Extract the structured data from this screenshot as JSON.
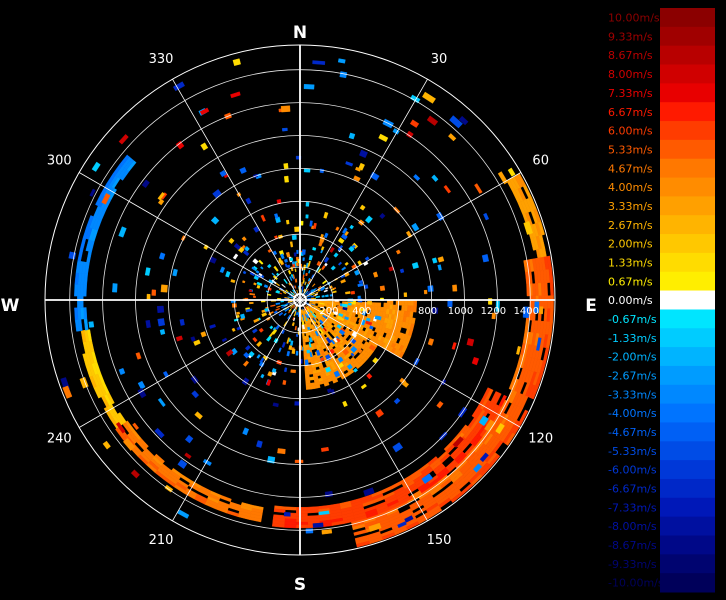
{
  "chart_data": {
    "type": "heatmap",
    "subtype": "polar-radial-velocity",
    "cardinals": [
      "N",
      "E",
      "S",
      "W"
    ],
    "azimuth_labels": [
      30,
      60,
      120,
      150,
      210,
      240,
      300,
      330
    ],
    "range_ticks": [
      200,
      400,
      800,
      1000,
      1200,
      1400
    ],
    "range_max": 1550,
    "range_ring_step": 200,
    "spoke_step_deg": 30,
    "legend": {
      "labels": [
        "10.00m/s",
        "9.33m/s",
        "8.67m/s",
        "8.00m/s",
        "7.33m/s",
        "6.67m/s",
        "6.00m/s",
        "5.33m/s",
        "4.67m/s",
        "4.00m/s",
        "3.33m/s",
        "2.67m/s",
        "2.00m/s",
        "1.33m/s",
        "0.67m/s",
        "0.00m/s",
        "-0.67m/s",
        "-1.33m/s",
        "-2.00m/s",
        "-2.67m/s",
        "-3.33m/s",
        "-4.00m/s",
        "-4.67m/s",
        "-5.33m/s",
        "-6.00m/s",
        "-6.67m/s",
        "-7.33m/s",
        "-8.00m/s",
        "-8.67m/s",
        "-9.33m/s",
        "-10.00m/s"
      ],
      "colors": [
        "#8b0000",
        "#a00000",
        "#b80000",
        "#d00000",
        "#e80000",
        "#ff1a00",
        "#ff3c00",
        "#ff5a00",
        "#ff7800",
        "#ff8c00",
        "#ffa000",
        "#ffb400",
        "#ffc800",
        "#ffdc00",
        "#ffee00",
        "#ffffff",
        "#00e5ff",
        "#00ccff",
        "#00b4ff",
        "#009cff",
        "#0088ff",
        "#0074ff",
        "#0060f5",
        "#004ce6",
        "#0038d8",
        "#0028c8",
        "#0018b8",
        "#0010a0",
        "#000888",
        "#000470",
        "#00005a"
      ]
    },
    "velocity_regions": [
      {
        "az": [
          92,
          175
        ],
        "r": [
          60,
          530
        ],
        "v": [
          3.33,
          4.0
        ]
      },
      {
        "az": [
          90,
          120
        ],
        "r": [
          530,
          700
        ],
        "v": [
          3.33,
          4.67
        ]
      },
      {
        "az": [
          60,
          80
        ],
        "r": [
          1450,
          1540
        ],
        "v": [
          3.33,
          4.0
        ]
      },
      {
        "az": [
          80,
          165
        ],
        "r": [
          1380,
          1540
        ],
        "v": [
          4.67,
          6.0
        ]
      },
      {
        "az": [
          115,
          185
        ],
        "r": [
          1260,
          1380
        ],
        "v": [
          5.33,
          6.67
        ]
      },
      {
        "az": [
          190,
          235
        ],
        "r": [
          1280,
          1360
        ],
        "v": [
          4.0,
          5.33
        ]
      },
      {
        "az": [
          235,
          262
        ],
        "r": [
          1290,
          1350
        ],
        "v": [
          1.33,
          2.67
        ]
      },
      {
        "az": [
          262,
          310
        ],
        "r": [
          1300,
          1360
        ],
        "v": [
          -2.67,
          -4.0
        ]
      },
      {
        "az": [
          0,
          360
        ],
        "r": [
          40,
          500
        ],
        "v": [
          -10,
          10
        ],
        "note": "scattered gates"
      }
    ]
  }
}
